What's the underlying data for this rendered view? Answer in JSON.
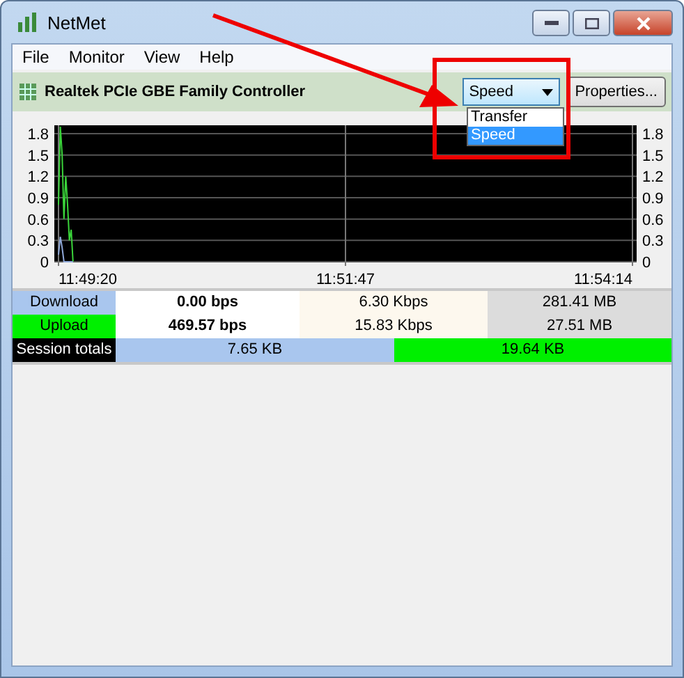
{
  "window": {
    "title": "NetMet"
  },
  "menu": [
    "File",
    "Monitor",
    "View",
    "Help"
  ],
  "toolbar": {
    "adapter": "Realtek PCIe GBE Family Controller",
    "mode": "Speed",
    "mode_options": [
      {
        "label": "Transfer",
        "selected": false
      },
      {
        "label": "Speed",
        "selected": true
      }
    ],
    "properties_button": "Properties..."
  },
  "graph": {
    "left_labels": [
      "1.8",
      "1.5",
      "1.2",
      "0.9",
      "0.6",
      "0.3",
      "0"
    ],
    "right_labels": [
      "1.8",
      "1.5",
      "1.2",
      "0.9",
      "0.6",
      "0.3",
      "0"
    ],
    "time_labels": [
      "11:49:20",
      "11:51:47",
      "11:54:14"
    ]
  },
  "stats": [
    {
      "label": "Download",
      "color": "#a9c6ee",
      "current": "0.00 bps",
      "average": "6.30 Kbps",
      "total": "281.41 MB"
    },
    {
      "label": "Upload",
      "color": "#00f000",
      "current": "469.57 bps",
      "average": "15.83 Kbps",
      "total": "27.51 MB"
    }
  ],
  "session": {
    "label": "Session totals",
    "download": "7.65 KB",
    "upload": "19.64 KB"
  }
}
